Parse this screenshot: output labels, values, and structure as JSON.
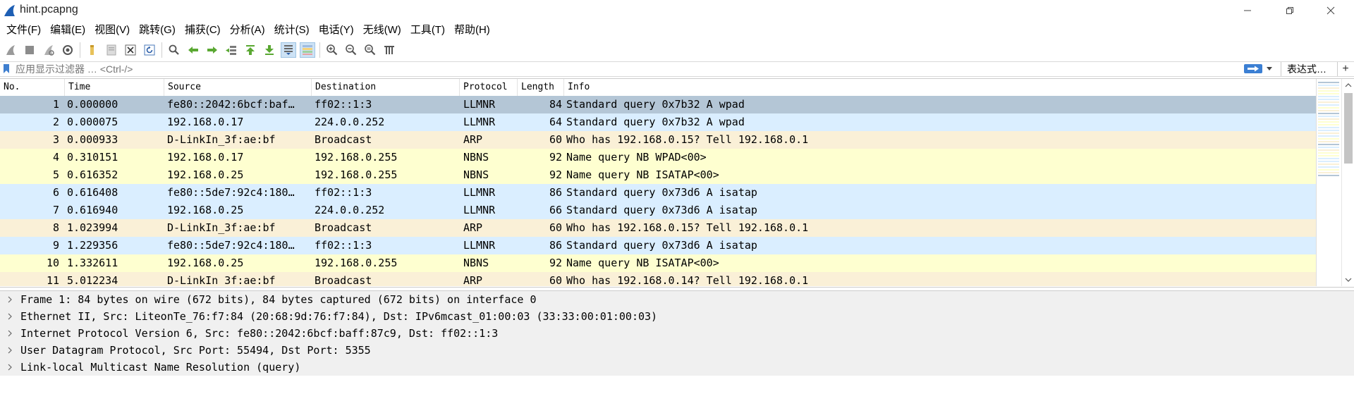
{
  "window": {
    "title": "hint.pcapng"
  },
  "menu": [
    {
      "label": "文件(F)"
    },
    {
      "label": "编辑(E)"
    },
    {
      "label": "视图(V)"
    },
    {
      "label": "跳转(G)"
    },
    {
      "label": "捕获(C)"
    },
    {
      "label": "分析(A)"
    },
    {
      "label": "统计(S)"
    },
    {
      "label": "电话(Y)"
    },
    {
      "label": "无线(W)"
    },
    {
      "label": "工具(T)"
    },
    {
      "label": "帮助(H)"
    }
  ],
  "toolbar": {
    "buttons": [
      "start-capture-icon",
      "stop-capture-icon",
      "restart-capture-icon",
      "capture-options-icon",
      "open-file-icon",
      "save-file-icon",
      "close-file-icon",
      "reload-file-icon",
      "find-packet-icon",
      "go-back-icon",
      "go-forward-icon",
      "go-to-packet-icon",
      "first-packet-icon",
      "last-packet-icon",
      "autoscroll-icon",
      "colorize-icon",
      "zoom-in-icon",
      "zoom-out-icon",
      "normal-size-icon",
      "resize-columns-icon"
    ]
  },
  "filter": {
    "placeholder": "应用显示过滤器 … <Ctrl-/>",
    "expression_label": "表达式…",
    "add_label": "+"
  },
  "packet_list": {
    "columns": [
      "No.",
      "Time",
      "Source",
      "Destination",
      "Protocol",
      "Length",
      "Info"
    ],
    "rows": [
      {
        "no": "1",
        "time": "0.000000",
        "source": "fe80::2042:6bcf:baf…",
        "destination": "ff02::1:3",
        "protocol": "LLMNR",
        "length": "84",
        "info": "Standard query 0x7b32 A wpad",
        "color": "#b4c6d6",
        "selected": true
      },
      {
        "no": "2",
        "time": "0.000075",
        "source": "192.168.0.17",
        "destination": "224.0.0.252",
        "protocol": "LLMNR",
        "length": "64",
        "info": "Standard query 0x7b32 A wpad",
        "color": "#daeeff"
      },
      {
        "no": "3",
        "time": "0.000933",
        "source": "D-LinkIn_3f:ae:bf",
        "destination": "Broadcast",
        "protocol": "ARP",
        "length": "60",
        "info": "Who has 192.168.0.15? Tell 192.168.0.1",
        "color": "#faf0d7"
      },
      {
        "no": "4",
        "time": "0.310151",
        "source": "192.168.0.17",
        "destination": "192.168.0.255",
        "protocol": "NBNS",
        "length": "92",
        "info": "Name query NB WPAD<00>",
        "color": "#feffd0"
      },
      {
        "no": "5",
        "time": "0.616352",
        "source": "192.168.0.25",
        "destination": "192.168.0.255",
        "protocol": "NBNS",
        "length": "92",
        "info": "Name query NB ISATAP<00>",
        "color": "#feffd0"
      },
      {
        "no": "6",
        "time": "0.616408",
        "source": "fe80::5de7:92c4:180…",
        "destination": "ff02::1:3",
        "protocol": "LLMNR",
        "length": "86",
        "info": "Standard query 0x73d6 A isatap",
        "color": "#daeeff"
      },
      {
        "no": "7",
        "time": "0.616940",
        "source": "192.168.0.25",
        "destination": "224.0.0.252",
        "protocol": "LLMNR",
        "length": "66",
        "info": "Standard query 0x73d6 A isatap",
        "color": "#daeeff"
      },
      {
        "no": "8",
        "time": "1.023994",
        "source": "D-LinkIn_3f:ae:bf",
        "destination": "Broadcast",
        "protocol": "ARP",
        "length": "60",
        "info": "Who has 192.168.0.15? Tell 192.168.0.1",
        "color": "#faf0d7"
      },
      {
        "no": "9",
        "time": "1.229356",
        "source": "fe80::5de7:92c4:180…",
        "destination": "ff02::1:3",
        "protocol": "LLMNR",
        "length": "86",
        "info": "Standard query 0x73d6 A isatap",
        "color": "#daeeff"
      },
      {
        "no": "10",
        "time": "1.332611",
        "source": "192.168.0.25",
        "destination": "192.168.0.255",
        "protocol": "NBNS",
        "length": "92",
        "info": "Name query NB ISATAP<00>",
        "color": "#feffd0"
      },
      {
        "no": "11",
        "time": "5.012234",
        "source": "D-LinkIn_3f:ae:bf",
        "destination": "Broadcast",
        "protocol": "ARP",
        "length": "60",
        "info": "Who has 192.168.0.14? Tell 192.168.0.1",
        "color": "#faf0d7"
      }
    ]
  },
  "details": [
    "Frame 1: 84 bytes on wire (672 bits), 84 bytes captured (672 bits) on interface 0",
    "Ethernet II, Src: LiteonTe_76:f7:84 (20:68:9d:76:f7:84), Dst: IPv6mcast_01:00:03 (33:33:00:01:00:03)",
    "Internet Protocol Version 6, Src: fe80::2042:6bcf:baff:87c9, Dst: ff02::1:3",
    "User Datagram Protocol, Src Port: 55494, Dst Port: 5355",
    "Link-local Multicast Name Resolution (query)"
  ]
}
